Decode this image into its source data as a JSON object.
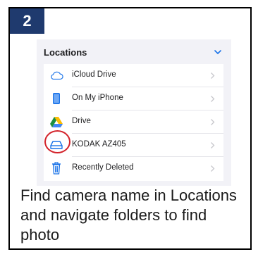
{
  "step": {
    "number": "2"
  },
  "locations": {
    "header": "Locations",
    "collapse_icon": "chevron-down-icon",
    "items": [
      {
        "label": "iCloud Drive",
        "icon": "cloud-icon"
      },
      {
        "label": "On My iPhone",
        "icon": "iphone-icon"
      },
      {
        "label": "Drive",
        "icon": "google-drive-icon"
      },
      {
        "label": "KODAK AZ405",
        "icon": "external-drive-icon"
      },
      {
        "label": "Recently Deleted",
        "icon": "trash-icon"
      }
    ]
  },
  "caption": {
    "text": "Find camera name in Locations and navigate folders to find photo"
  },
  "colors": {
    "badge": "#1f3a6e",
    "ios_blue": "#1a73e8",
    "highlight": "#d3222a"
  }
}
